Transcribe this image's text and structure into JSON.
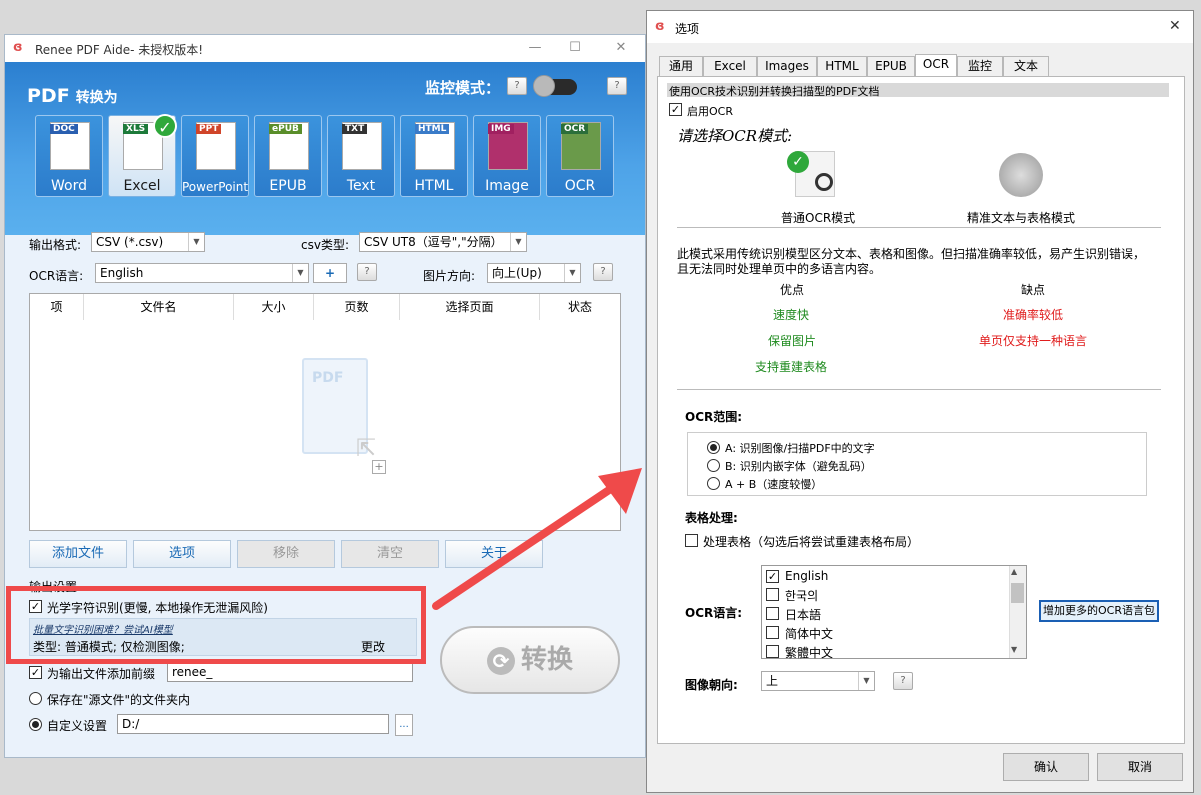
{
  "main": {
    "title": "Renee PDF Aide- 未授权版本!",
    "pdf_label": "PDF",
    "convert_to": "转换为",
    "monitor_label": "监控模式：",
    "help": "?",
    "formats": [
      {
        "tag": "DOC",
        "label": "Word"
      },
      {
        "tag": "XLS",
        "label": "Excel"
      },
      {
        "tag": "PPT",
        "label": "PowerPoint"
      },
      {
        "tag": "ePUB",
        "label": "EPUB"
      },
      {
        "tag": "TXT",
        "label": "Text"
      },
      {
        "tag": "HTML",
        "label": "HTML"
      },
      {
        "tag": "IMG",
        "label": "Image"
      },
      {
        "tag": "OCR",
        "label": "OCR"
      }
    ],
    "output_format_label": "输出格式:",
    "output_format_value": "CSV (*.csv)",
    "csv_type_label": "csv类型:",
    "csv_type_value": "CSV UT8（逗号\",\"分隔）",
    "ocr_lang_label": "OCR语言:",
    "ocr_lang_value": "English",
    "add_lang": "+",
    "img_dir_label": "图片方向:",
    "img_dir_value": "向上(Up)",
    "table_headers": [
      "项",
      "文件名",
      "大小",
      "页数",
      "选择页面",
      "状态"
    ],
    "drop_icon_text": "PDF",
    "buttons": {
      "add": "添加文件",
      "options": "选项",
      "remove": "移除",
      "clear": "清空",
      "about": "关于"
    },
    "output_settings": "输出设置",
    "ocr_check": "光学字符识别(更慢, 本地操作无泄漏风险)",
    "ai_link": "批量文字识别困难？尝试AI模型",
    "type_text": "类型:  普通模式; 仅检测图像;",
    "change": "更改",
    "prefix_check": "为输出文件添加前缀",
    "prefix_value": "renee_",
    "save_source": "保存在\"源文件\"的文件夹内",
    "custom": "自定义设置",
    "custom_path": "D:/",
    "browse": "...",
    "convert": "转换"
  },
  "options": {
    "title": "选项",
    "tabs": [
      "通用",
      "Excel",
      "Images",
      "HTML",
      "EPUB",
      "OCR",
      "监控",
      "文本"
    ],
    "selected_tab": "OCR",
    "header": "使用OCR技术识别并转换扫描型的PDF文档",
    "enable_ocr": "启用OCR",
    "choose_mode": "请选择OCR模式:",
    "mode_normal": "普通OCR模式",
    "mode_precise": "精准文本与表格模式",
    "mode_desc1": "此模式采用传统识别模型区分文本、表格和图像。但扫描准确率较低，易产生识别错误，",
    "mode_desc2": "且无法同时处理单页中的多语言内容。",
    "pros_title": "优点",
    "cons_title": "缺点",
    "pros": [
      "速度快",
      "保留图片",
      "支持重建表格"
    ],
    "cons": [
      "准确率较低",
      "单页仅支持一种语言"
    ],
    "range_title": "OCR范围:",
    "ranges": [
      "A: 识别图像/扫描PDF中的文字",
      "B: 识别内嵌字体（避免乱码）",
      "A + B（速度较慢）"
    ],
    "table_title": "表格处理:",
    "table_check": "处理表格（勾选后将尝试重建表格布局）",
    "lang_title": "OCR语言:",
    "langs": [
      "English",
      "한국의",
      "日本語",
      "简体中文",
      "繁體中文"
    ],
    "add_lang_pack": "增加更多的OCR语言包",
    "orient_title": "图像朝向:",
    "orient_value": "上",
    "ok": "确认",
    "cancel": "取消"
  },
  "colors": {
    "accent": "#2b7fd0",
    "red_box": "#ef4a4a",
    "pro": "#1e8a1e",
    "con": "#e01b1b"
  }
}
